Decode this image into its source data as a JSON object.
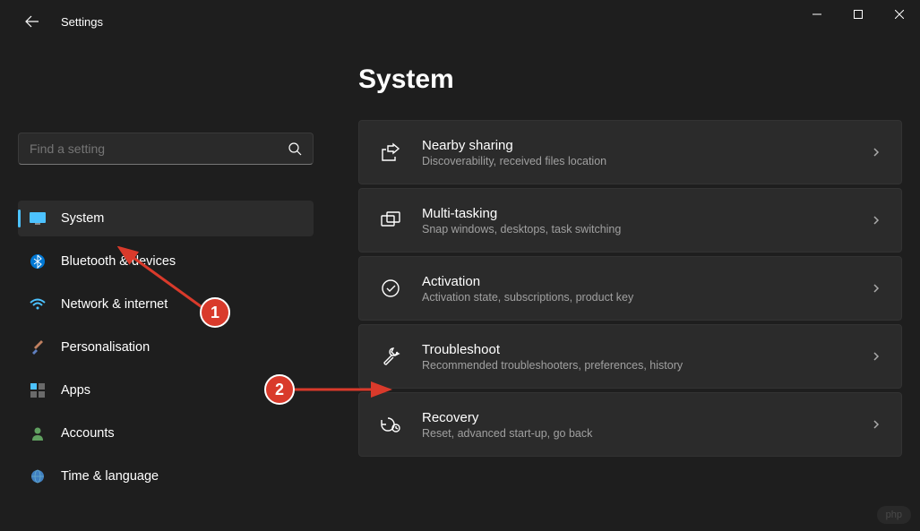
{
  "app": {
    "title": "Settings"
  },
  "search": {
    "placeholder": "Find a setting"
  },
  "nav": {
    "items": [
      {
        "label": "System",
        "active": true,
        "icon": "display"
      },
      {
        "label": "Bluetooth & devices",
        "active": false,
        "icon": "bluetooth"
      },
      {
        "label": "Network & internet",
        "active": false,
        "icon": "wifi"
      },
      {
        "label": "Personalisation",
        "active": false,
        "icon": "brush"
      },
      {
        "label": "Apps",
        "active": false,
        "icon": "apps"
      },
      {
        "label": "Accounts",
        "active": false,
        "icon": "account"
      },
      {
        "label": "Time & language",
        "active": false,
        "icon": "globe"
      }
    ]
  },
  "page": {
    "title": "System"
  },
  "cards": [
    {
      "title": "Nearby sharing",
      "desc": "Discoverability, received files location",
      "icon": "share"
    },
    {
      "title": "Multi-tasking",
      "desc": "Snap windows, desktops, task switching",
      "icon": "multitask"
    },
    {
      "title": "Activation",
      "desc": "Activation state, subscriptions, product key",
      "icon": "check"
    },
    {
      "title": "Troubleshoot",
      "desc": "Recommended troubleshooters, preferences, history",
      "icon": "wrench"
    },
    {
      "title": "Recovery",
      "desc": "Reset, advanced start-up, go back",
      "icon": "recovery"
    }
  ],
  "annotations": {
    "badge1": "1",
    "badge2": "2"
  },
  "watermark": "php"
}
